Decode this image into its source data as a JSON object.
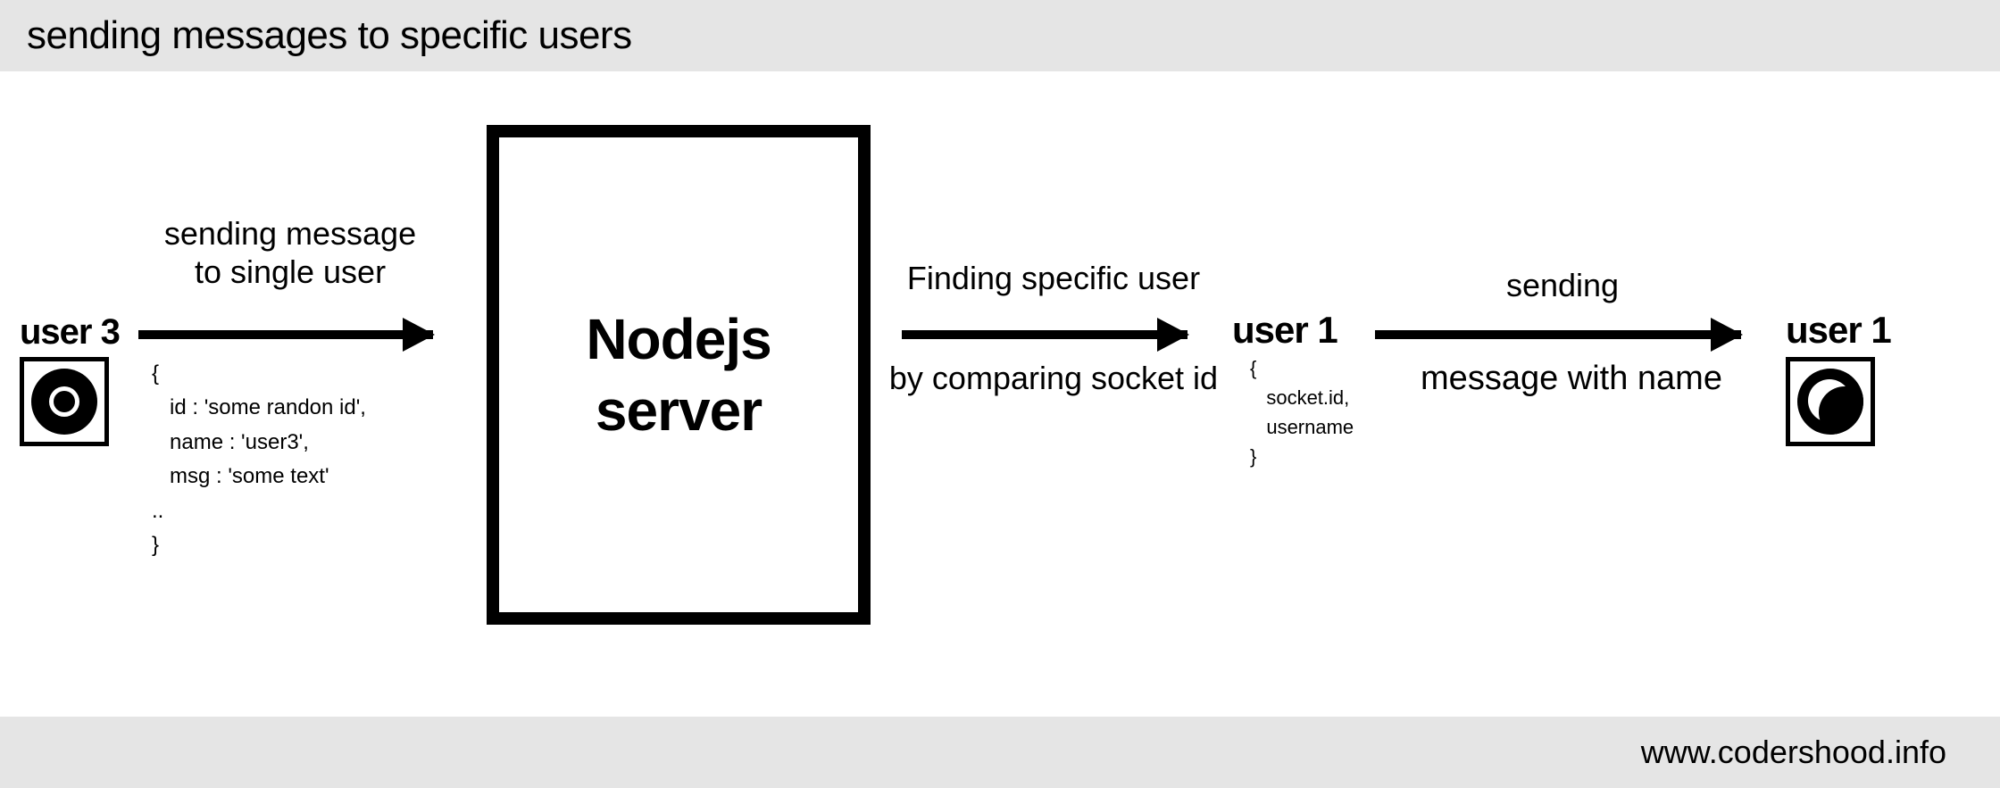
{
  "header": {
    "title": "sending messages to specific users"
  },
  "footer": {
    "url": "www.codershood.info"
  },
  "user3": {
    "label": "user 3",
    "browser": "chrome"
  },
  "user1_left": {
    "label": "user 1"
  },
  "user1_right": {
    "label": "user 1",
    "browser": "firefox"
  },
  "server": {
    "line1": "Nodejs",
    "line2": "server"
  },
  "arrow1": {
    "label_above": "sending message\nto single user",
    "payload": "{\n   id : 'some randon id',\n   name : 'user3',\n   msg : 'some text'\n..\n}"
  },
  "arrow2": {
    "label_above": "Finding specific user",
    "label_below": "by comparing socket id"
  },
  "arrow3": {
    "label_above": "sending",
    "label_below": "message with name",
    "payload": "{\n   socket.id,\n   username\n}"
  }
}
